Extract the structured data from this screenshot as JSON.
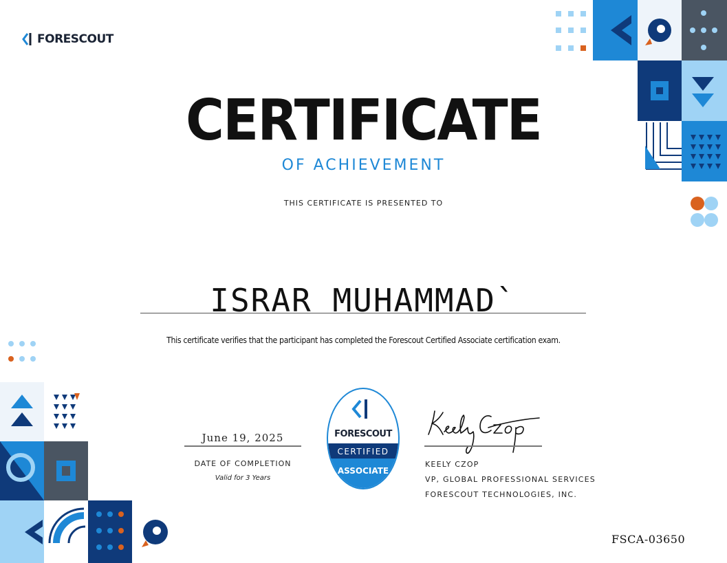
{
  "brand": {
    "name": "FORESCOUT"
  },
  "certificate": {
    "title": "CERTIFICATE",
    "subtitle": "OF ACHIEVEMENT",
    "presented_text": "THIS CERTIFICATE IS PRESENTED TO",
    "recipient": "ISRAR MUHAMMAD`",
    "verification_text": "This certificate verifies that the participant has completed the Forescout Certified Associate certification exam.",
    "date": "June 19, 2025",
    "date_label": "DATE OF COMPLETION",
    "validity": "Valid for 3 Years",
    "certificate_id": "FSCA-03650"
  },
  "badge": {
    "brand": "FORESCOUT",
    "line1": "CERTIFIED",
    "line2": "ASSOCIATE"
  },
  "signatory": {
    "name": "KEELY CZOP",
    "role": "VP, GLOBAL PROFESSIONAL SERVICES",
    "company": "FORESCOUT TECHNOLOGIES, INC."
  },
  "colors": {
    "primary_blue": "#1e88d6",
    "navy": "#0f3a7a",
    "light_blue": "#9fd3f5",
    "orange": "#d9621f",
    "slate": "#4a5562"
  }
}
